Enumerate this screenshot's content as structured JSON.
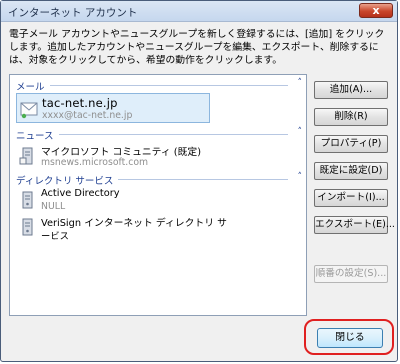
{
  "window": {
    "title": "インターネット アカウント",
    "close_glyph": "x"
  },
  "description": "電子メール アカウントやニュースグループを新しく登録するには、[追加] をクリックします。追加したアカウントやニュースグループを編集、エクスポート、削除するには、対象をクリックしてから、希望の動作をクリックします。",
  "groups": {
    "mail": {
      "label": "メール",
      "chevron": "˄"
    },
    "news": {
      "label": "ニュース",
      "chevron": "˄"
    },
    "directory": {
      "label": "ディレクトリ サービス",
      "chevron": "˄"
    }
  },
  "accounts": {
    "mail": [
      {
        "name": "tac-net.ne.jp",
        "sub": "xxxx@tac-net.ne.jp",
        "selected": true
      }
    ],
    "news": [
      {
        "name": "マイクロソフト コミュニティ (既定)",
        "sub": "msnews.microsoft.com"
      }
    ],
    "directory": [
      {
        "name": "Active Directory",
        "sub": "NULL"
      },
      {
        "name": "VeriSign インターネット ディレクトリ サ",
        "sub": "ービス"
      }
    ]
  },
  "buttons": {
    "add": "追加(A)...",
    "remove": "削除(R)",
    "properties": "プロパティ(P)",
    "set_default": "既定に設定(D)",
    "import": "インポート(I)...",
    "export": "エクスポート(E)...",
    "order": "順番の設定(S)...",
    "close": "閉じる"
  },
  "colors": {
    "accent_group": "#1f3f91",
    "highlight": "#e02020",
    "selection": "#dfeefa"
  }
}
